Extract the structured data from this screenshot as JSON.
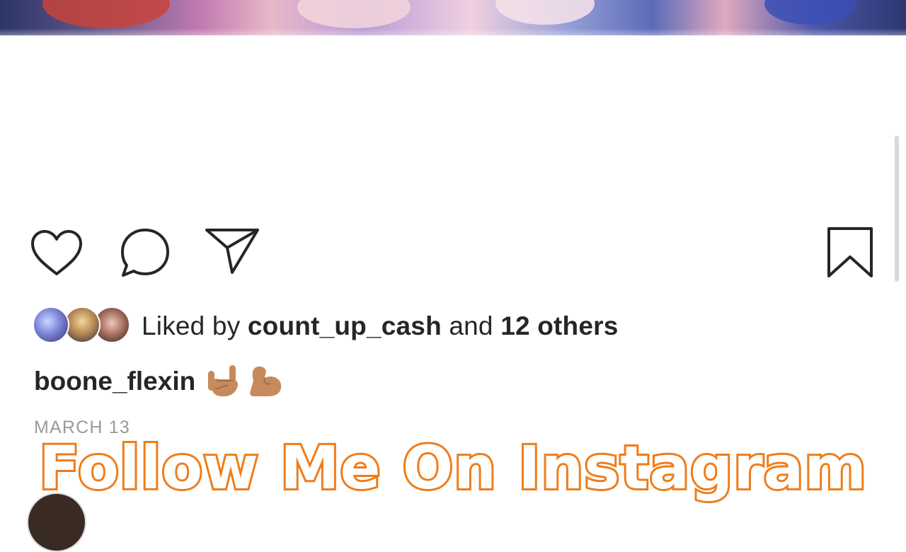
{
  "post": {
    "liked_by_prefix": "Liked by ",
    "liked_by_user": "count_up_cash",
    "liked_by_middle": " and ",
    "liked_by_others": "12 others",
    "caption_user": "boone_flexin",
    "caption_emojis": "🤟🏽💪🏽",
    "date": "MARCH 13"
  },
  "overlay": {
    "text": "Follow Me On Instagram"
  },
  "icons": {
    "like": "heart-icon",
    "comment": "comment-icon",
    "share": "paper-plane-icon",
    "save": "bookmark-icon"
  },
  "colors": {
    "text": "#262626",
    "muted": "#9a9a9a",
    "overlay_fill": "#ffffff",
    "overlay_stroke": "#ef7d1a"
  }
}
